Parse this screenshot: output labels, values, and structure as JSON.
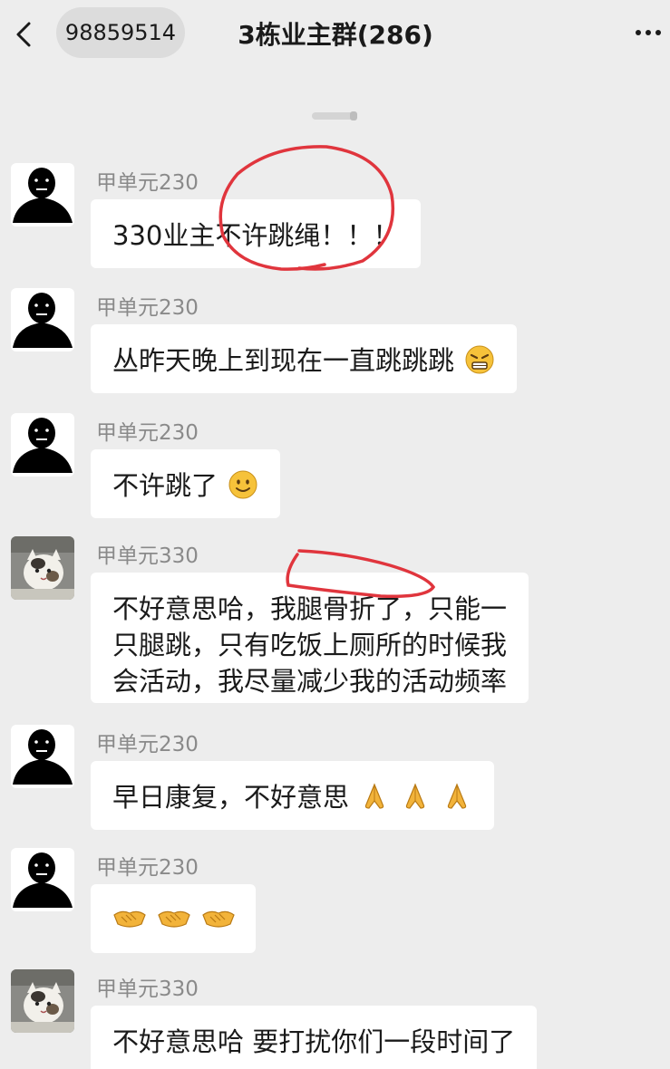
{
  "header": {
    "back_icon": "chevron-left-icon",
    "chat_id": "98859514",
    "title": "3栋业主群(286)",
    "more_icon": "more-dots-icon"
  },
  "messages": [
    {
      "sender": "甲单元230",
      "avatar": "black-silhouette-avatar",
      "text": "330业主不许跳绳！！！",
      "emoji": []
    },
    {
      "sender": "甲单元230",
      "avatar": "black-silhouette-avatar",
      "text": "丛昨天晚上到现在一直跳跳跳",
      "emoji": [
        "angry-grimace-emoji"
      ]
    },
    {
      "sender": "甲单元230",
      "avatar": "black-silhouette-avatar",
      "text": "不许跳了",
      "emoji": [
        "smile-emoji"
      ]
    },
    {
      "sender": "甲单元330",
      "avatar": "cat-photo-avatar",
      "lines": [
        "不好意思哈，我腿骨折了，只能一",
        "只腿跳，只有吃饭上厕所的时候我",
        "会活动，我尽量减少我的活动频率"
      ],
      "emoji": []
    },
    {
      "sender": "甲单元230",
      "avatar": "black-silhouette-avatar",
      "text": "早日康复，不好意思",
      "emoji": [
        "praying-hands-emoji",
        "praying-hands-emoji",
        "praying-hands-emoji"
      ]
    },
    {
      "sender": "甲单元230",
      "avatar": "black-silhouette-avatar",
      "text": "",
      "emoji": [
        "handshake-emoji",
        "handshake-emoji",
        "handshake-emoji"
      ]
    },
    {
      "sender": "甲单元330",
      "avatar": "cat-photo-avatar",
      "text": "不好意思哈 要打扰你们一段时间了",
      "emoji": []
    }
  ],
  "colors": {
    "background": "#ededed",
    "bubble": "#ffffff",
    "annotation_red": "#e0353d"
  }
}
